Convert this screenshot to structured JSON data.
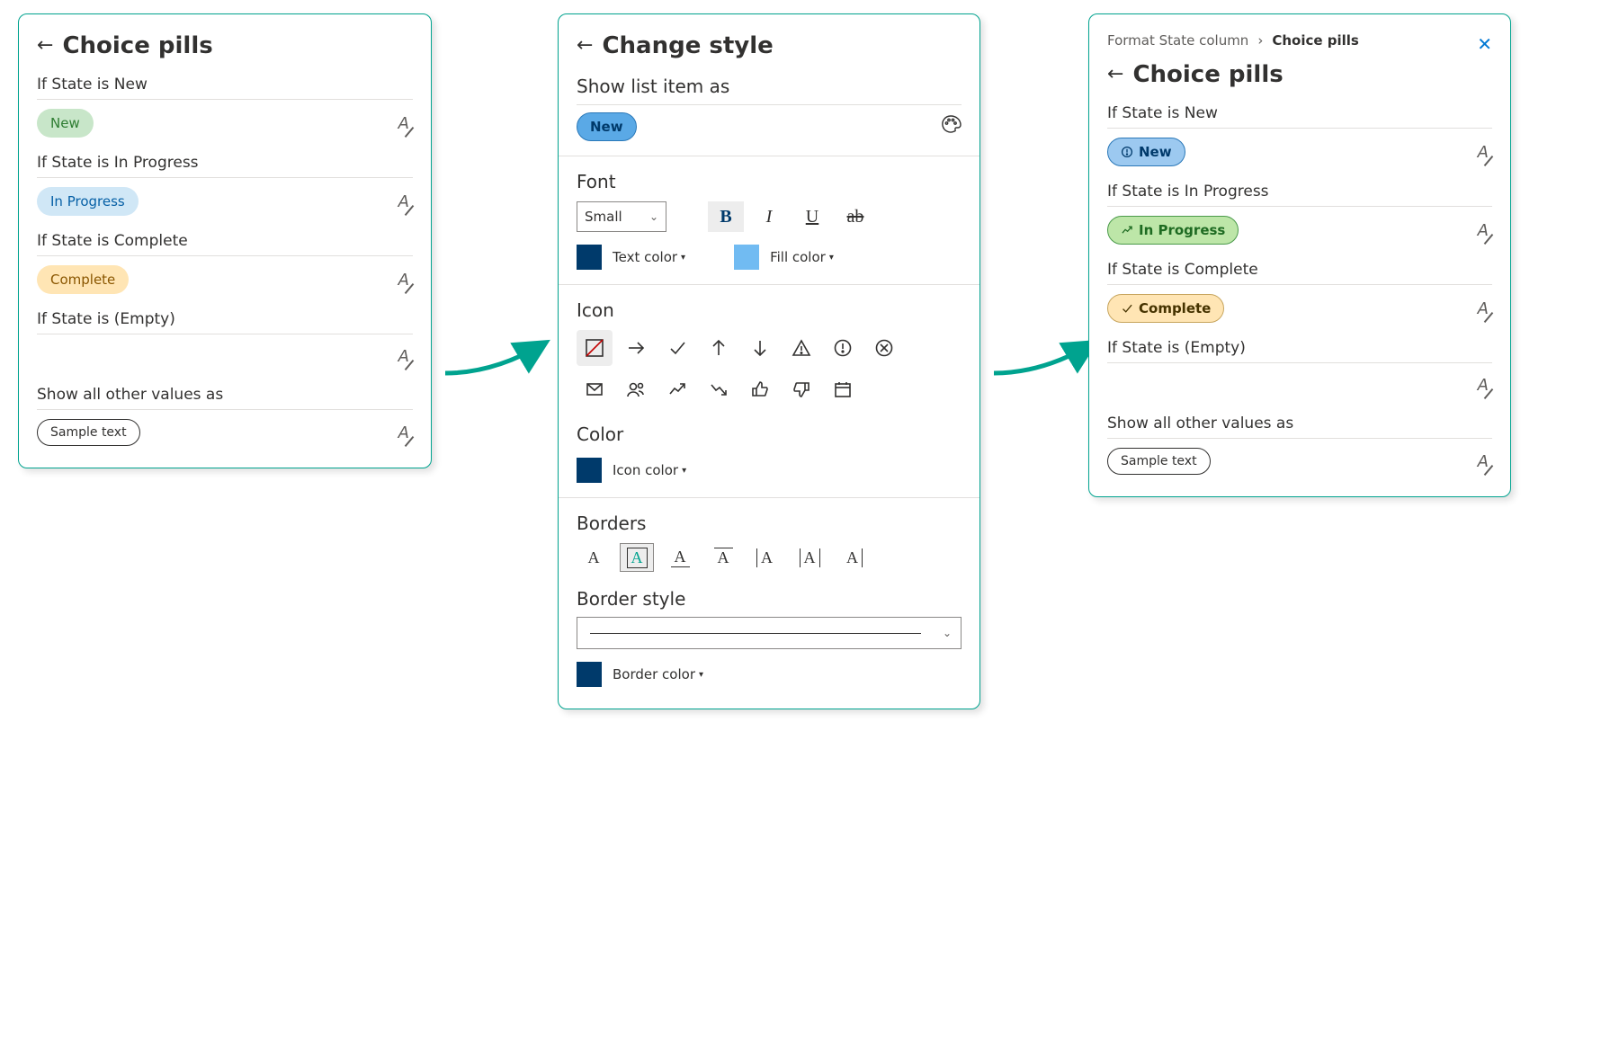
{
  "panel1": {
    "title": "Choice pills",
    "rules": {
      "new_label": "If State is New",
      "new_pill": "New",
      "inprog_label": "If State is In Progress",
      "inprog_pill": "In Progress",
      "complete_label": "If State is Complete",
      "complete_pill": "Complete",
      "empty_label": "If State is (Empty)",
      "other_label": "Show all other values as",
      "other_pill": "Sample text"
    }
  },
  "panel2": {
    "title": "Change style",
    "show_as_heading": "Show list item as",
    "preview_pill": "New",
    "font_heading": "Font",
    "font_size_value": "Small",
    "text_color_label": "Text color",
    "text_color_hex": "#003a6b",
    "fill_color_label": "Fill color",
    "fill_color_hex": "#71bbf2",
    "icon_heading": "Icon",
    "color_heading": "Color",
    "icon_color_label": "Icon color",
    "icon_color_hex": "#003a6b",
    "borders_heading": "Borders",
    "border_style_heading": "Border style",
    "border_color_label": "Border color",
    "border_color_hex": "#003a6b"
  },
  "panel3": {
    "breadcrumb_root": "Format State column",
    "breadcrumb_current": "Choice pills",
    "title": "Choice pills",
    "rules": {
      "new_label": "If State is New",
      "new_pill": "New",
      "inprog_label": "If State is In Progress",
      "inprog_pill": "In Progress",
      "complete_label": "If State is Complete",
      "complete_pill": "Complete",
      "empty_label": "If State is (Empty)",
      "other_label": "Show all other values as",
      "other_pill": "Sample text"
    }
  }
}
